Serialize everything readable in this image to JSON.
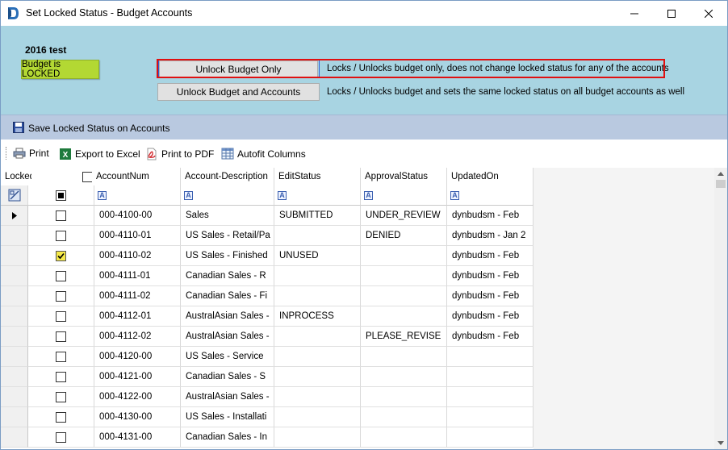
{
  "window": {
    "title": "Set Locked Status - Budget Accounts"
  },
  "budget": {
    "name": "2016 test",
    "status_badge": "Budget is LOCKED",
    "badge_color": "#b3d833"
  },
  "actions": {
    "unlock_only_label": "Unlock Budget Only",
    "unlock_only_desc": "Locks / Unlocks budget only, does not change locked status for any of the accounts",
    "unlock_all_label": "Unlock Budget and Accounts",
    "unlock_all_desc": "Locks / Unlocks budget and sets the same locked status on all budget accounts as well"
  },
  "save_bar": {
    "label": "Save Locked Status on Accounts"
  },
  "toolbar": {
    "print": "Print",
    "export_excel": "Export to Excel",
    "print_pdf": "Print to PDF",
    "autofit": "Autofit Columns"
  },
  "grid": {
    "columns": [
      "Locked",
      "AccountNum",
      "Account-Description",
      "EditStatus",
      "ApprovalStatus",
      "UpdatedOn"
    ],
    "rows": [
      {
        "locked": false,
        "account": "000-4100-00",
        "desc": "Sales",
        "edit": "SUBMITTED",
        "approval": "UNDER_REVIEW",
        "updated": "dynbudsm - Feb",
        "current": true
      },
      {
        "locked": false,
        "account": "000-4110-01",
        "desc": "US Sales - Retail/Pa",
        "edit": "",
        "approval": "DENIED",
        "updated": "dynbudsm - Jan 2"
      },
      {
        "locked": true,
        "account": "000-4110-02",
        "desc": "US Sales - Finished",
        "edit": "UNUSED",
        "approval": "",
        "updated": "dynbudsm - Feb"
      },
      {
        "locked": false,
        "account": "000-4111-01",
        "desc": "Canadian Sales - R",
        "edit": "",
        "approval": "",
        "updated": "dynbudsm - Feb"
      },
      {
        "locked": false,
        "account": "000-4111-02",
        "desc": "Canadian Sales - Fi",
        "edit": "",
        "approval": "",
        "updated": "dynbudsm - Feb"
      },
      {
        "locked": false,
        "account": "000-4112-01",
        "desc": "AustralAsian Sales -",
        "edit": "INPROCESS",
        "approval": "",
        "updated": "dynbudsm - Feb"
      },
      {
        "locked": false,
        "account": "000-4112-02",
        "desc": "AustralAsian Sales -",
        "edit": "",
        "approval": "PLEASE_REVISE",
        "updated": "dynbudsm - Feb"
      },
      {
        "locked": false,
        "account": "000-4120-00",
        "desc": "US Sales - Service",
        "edit": "",
        "approval": "",
        "updated": ""
      },
      {
        "locked": false,
        "account": "000-4121-00",
        "desc": "Canadian Sales - S",
        "edit": "",
        "approval": "",
        "updated": ""
      },
      {
        "locked": false,
        "account": "000-4122-00",
        "desc": "AustralAsian Sales -",
        "edit": "",
        "approval": "",
        "updated": ""
      },
      {
        "locked": false,
        "account": "000-4130-00",
        "desc": "US Sales - Installati",
        "edit": "",
        "approval": "",
        "updated": ""
      },
      {
        "locked": false,
        "account": "000-4131-00",
        "desc": "Canadian Sales - In",
        "edit": "",
        "approval": "",
        "updated": ""
      }
    ]
  },
  "colors": {
    "top_panel": "#a8d4e2",
    "save_bar": "#b9c9e0",
    "highlight_red": "#e01010",
    "check_yellow": "#f5e94a"
  }
}
